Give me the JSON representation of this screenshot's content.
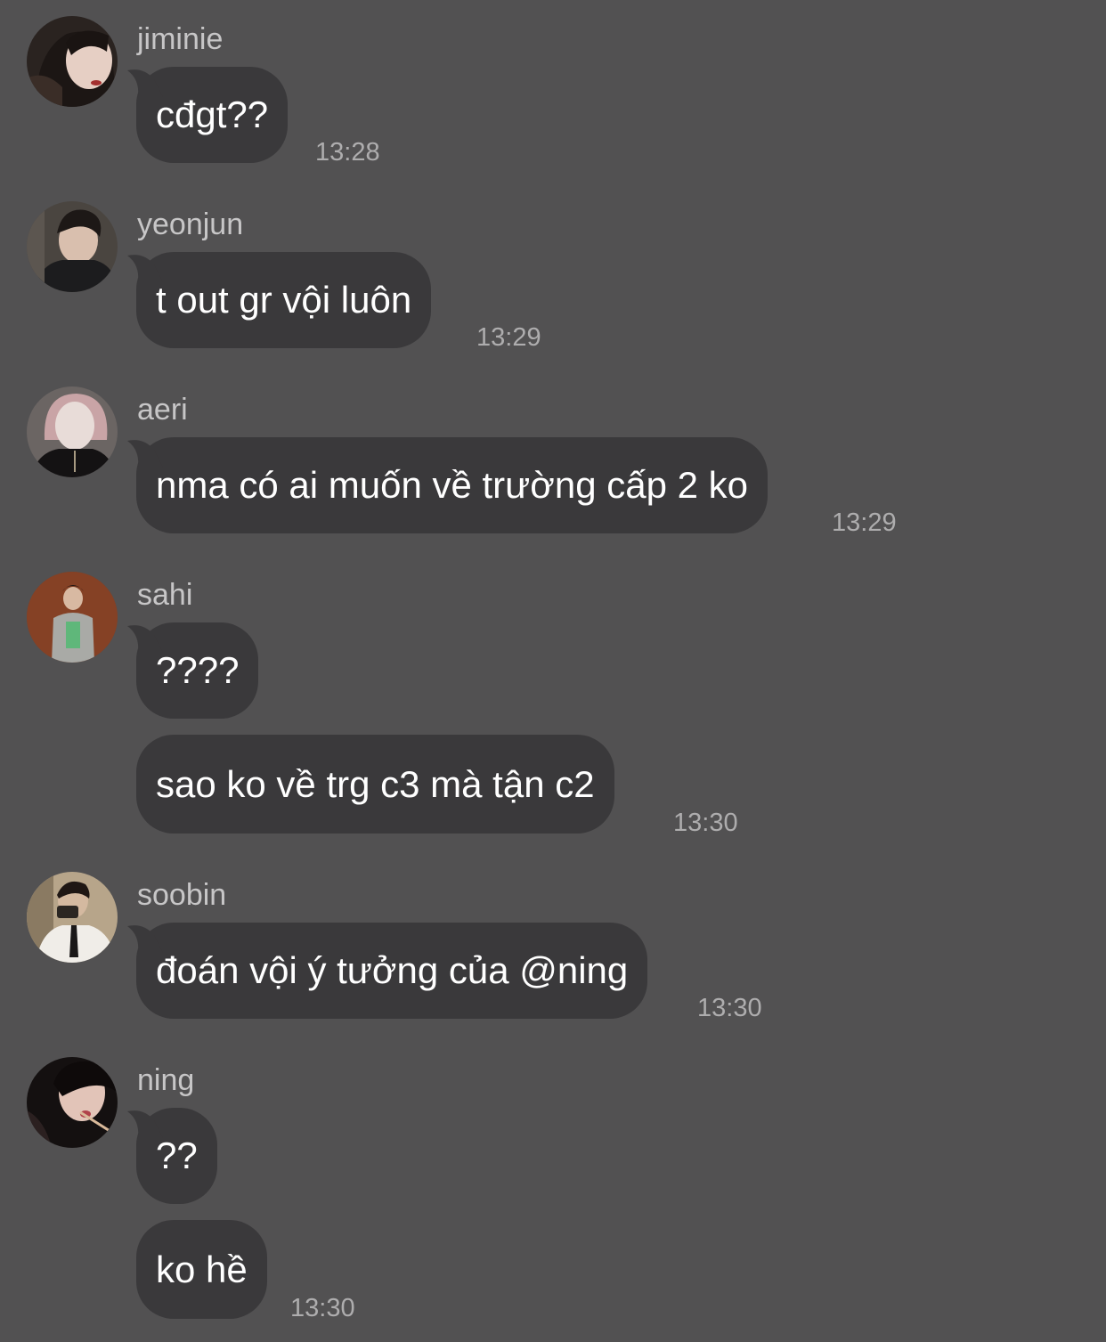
{
  "colors": {
    "background": "#525152",
    "bubble": "#3a393b",
    "name_text": "#c7c6c7",
    "message_text": "#ffffff",
    "time_text": "#aeadae"
  },
  "messages": [
    {
      "sender": "jiminie",
      "avatar_icon": "avatar-jiminie-icon",
      "bubbles": [
        "cđgt??"
      ],
      "time": "13:28"
    },
    {
      "sender": "yeonjun",
      "avatar_icon": "avatar-yeonjun-icon",
      "bubbles": [
        "t out gr vội luôn"
      ],
      "time": "13:29"
    },
    {
      "sender": "aeri",
      "avatar_icon": "avatar-aeri-icon",
      "bubbles": [
        "nma có ai muốn về trường cấp 2 ko"
      ],
      "time": "13:29"
    },
    {
      "sender": "sahi",
      "avatar_icon": "avatar-sahi-icon",
      "bubbles": [
        "????",
        "sao ko về trg c3 mà tận c2"
      ],
      "time": "13:30"
    },
    {
      "sender": "soobin",
      "avatar_icon": "avatar-soobin-icon",
      "bubbles": [
        "đoán vội ý tưởng của @ning"
      ],
      "time": "13:30"
    },
    {
      "sender": "ning",
      "avatar_icon": "avatar-ning-icon",
      "bubbles": [
        "??",
        "ko hề"
      ],
      "time": "13:30"
    }
  ]
}
